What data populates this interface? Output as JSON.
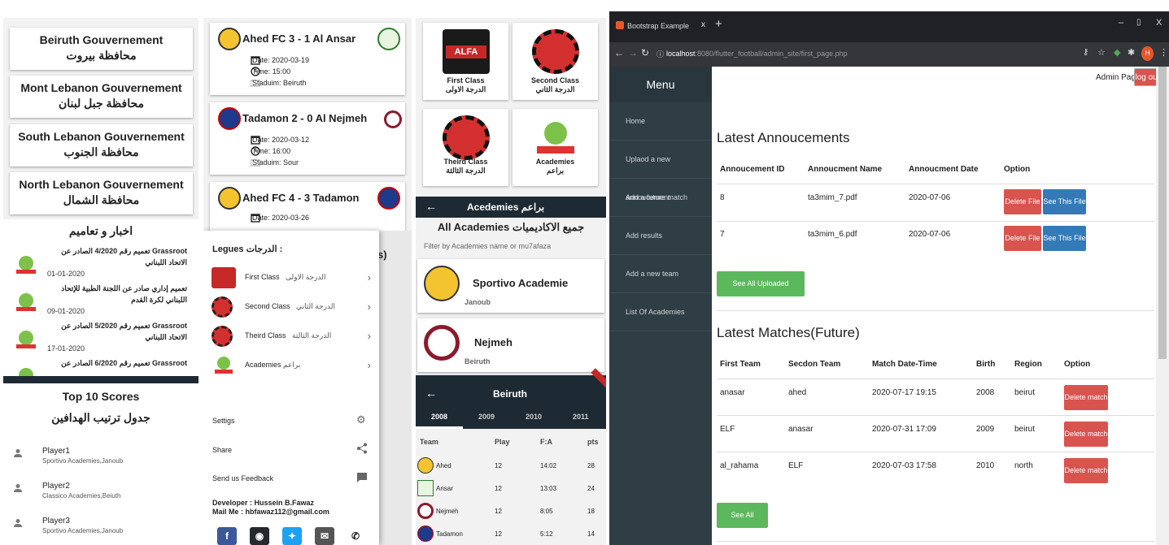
{
  "governorates": [
    {
      "en": "Beiruth Gouvernement",
      "ar": "محافظة بيروت"
    },
    {
      "en": "Mont Lebanon Gouvernement",
      "ar": "محافظة جبل لبنان"
    },
    {
      "en": "South Lebanon Gouvernement",
      "ar": "محافظة الجنوب"
    },
    {
      "en": "North Lebanon Gouvernement",
      "ar": "محافظة الشمال"
    }
  ],
  "news": {
    "title": "اخبار و تعاميم",
    "items": [
      {
        "text": "تعميم رقم 4/2020 الصادر عن  Grassroot الاتحاد اللبناني",
        "date": "01-01-2020"
      },
      {
        "text": "تعميم إداري صادر عن اللجنة الطبية للإتحاد اللبناني لكرة القدم",
        "date": "09-01-2020"
      },
      {
        "text": "تعميم رقم 5/2020 الصادر عن  Grassroot الاتحاد اللبناني",
        "date": "17-01-2020"
      },
      {
        "text": "تعميم رقم 6/2020 الصادر عن  Grassroot",
        "date": ""
      }
    ]
  },
  "scores": {
    "title": "Top 10 Scores",
    "subtitle": "جدول ترتيب الهدافين",
    "players": [
      {
        "name": "Player1",
        "sub": "Sportivo Academies,Janoub"
      },
      {
        "name": "Player2",
        "sub": "Classico Academies,Beiuth"
      },
      {
        "name": "Player3",
        "sub": "Sportivo Academies,Janoub"
      }
    ]
  },
  "matches": [
    {
      "title": "Ahed FC  3 - 1  Al Ansar",
      "date": "Date: 2020-03-19",
      "time": "Time: 15:00",
      "stadium": "Staduim: Beiruth"
    },
    {
      "title": "Tadamon  2 - 0  Al Nejmeh",
      "date": "Date: 2020-03-12",
      "time": "Time: 16:00",
      "stadium": "Staduim: Sour"
    },
    {
      "title": "Ahed FC  4 - 3  Tadamon",
      "date": "Date: 2020-03-26",
      "time": "",
      "stadium": ""
    }
  ],
  "drawer": {
    "title": "Legues الدرجات :",
    "items": [
      {
        "en": "First Class",
        "ar": "الدرجة الاولى"
      },
      {
        "en": "Second Class",
        "ar": "الدرجة الثاني"
      },
      {
        "en": "Theird Class",
        "ar": "الدرجة الثالثة"
      },
      {
        "en": "Academies",
        "ar": "براعم"
      }
    ],
    "settings": "Settigs",
    "share": "Share",
    "feedback": "Send us Feedback",
    "developer": "Developer : Hussein B.Fawaz",
    "mail": "Mail Me : hbfawaz112@gmail.com",
    "peek": "s)"
  },
  "classes": [
    {
      "en": "First Class",
      "ar": "الدرجة الاولى"
    },
    {
      "en": "Second Class",
      "ar": "الدرجة الثاني"
    },
    {
      "en": "Theird Class",
      "ar": "الدرجة الثالثة"
    },
    {
      "en": "Academies",
      "ar": "براعم"
    }
  ],
  "academies": {
    "bar": "Acedemies  براعم",
    "title": "All Academies  جميع الاكاديميات",
    "filter": "Filter by Academies name  or mu7afaza",
    "items": [
      {
        "name": "Sportivo  Academie",
        "region": "Janoub"
      },
      {
        "name": "Nejmeh",
        "region": "Beiruth"
      }
    ]
  },
  "league": {
    "title": "Beiruth",
    "years": [
      "2008",
      "2009",
      "2010",
      "2011"
    ],
    "headers": [
      "Team",
      "Play",
      "F:A",
      "pts"
    ],
    "rows": [
      {
        "team": "Ahed",
        "play": "12",
        "fa": "14:02",
        "pts": "28"
      },
      {
        "team": "Ansar",
        "play": "12",
        "fa": "13:03",
        "pts": "24"
      },
      {
        "team": "Nejmeh",
        "play": "12",
        "fa": "8:05",
        "pts": "18"
      },
      {
        "team": "Tadamon",
        "play": "12",
        "fa": "5:12",
        "pts": "14"
      }
    ]
  },
  "browser": {
    "tab": "Bootstrap Example",
    "url_host": "localhost",
    "url_rest": ":8080/flutter_football/admin_site/first_page.php",
    "profile": "H"
  },
  "admin": {
    "menu": "Menu",
    "nav": [
      "Home",
      "Uplaod a new annoucement",
      "Add a future match",
      "Add results",
      "Add a new team",
      "List Of Academies"
    ],
    "admin_page": "Admin Page",
    "logout": "log out",
    "ann_title": "Latest Annoucements",
    "ann_headers": [
      "Annoucement ID",
      "Annoucment Name",
      "Annoucment Date",
      "Option"
    ],
    "ann_rows": [
      {
        "id": "8",
        "name": "ta3mim_7.pdf",
        "date": "2020-07-06"
      },
      {
        "id": "7",
        "name": "ta3mim_6.pdf",
        "date": "2020-07-06"
      }
    ],
    "delete_file": "Delete File",
    "see_file": "See This File",
    "see_all_ann": "See All Uploaded Annoucment",
    "match_title": "Latest Matches(Future)",
    "match_headers": [
      "First Team",
      "Secdon Team",
      "Match Date-Time",
      "Birth",
      "Region",
      "Option"
    ],
    "match_rows": [
      {
        "t1": "anasar",
        "t2": "ahed",
        "dt": "2020-07-17 19:15",
        "birth": "2008",
        "region": "beirut"
      },
      {
        "t1": "ELF",
        "t2": "anasar",
        "dt": "2020-07-31 17:09",
        "birth": "2009",
        "region": "beirut"
      },
      {
        "t1": "al_rahama",
        "t2": "ELF",
        "dt": "2020-07-03 17:58",
        "birth": "2010",
        "region": "north"
      }
    ],
    "delete_match": "Delete match",
    "see_all_matches": "See All Matches"
  }
}
